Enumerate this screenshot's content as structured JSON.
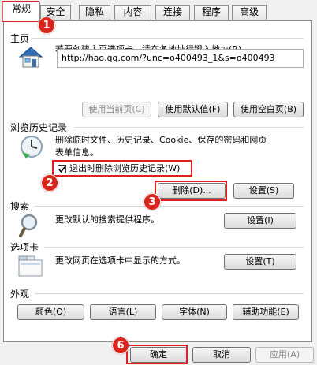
{
  "tabs": [
    {
      "label": "常规"
    },
    {
      "label": "安全"
    },
    {
      "label": "隐私"
    },
    {
      "label": "内容"
    },
    {
      "label": "连接"
    },
    {
      "label": "程序"
    },
    {
      "label": "高级"
    }
  ],
  "home": {
    "title": "主页",
    "description": "若要创建主页选项卡，请在各地址行键入地址(R)。",
    "url": "http://hao.qq.com/?unc=o400493_1&s=o400493",
    "btn_current": "使用当前页(C)",
    "btn_default": "使用默认值(F)",
    "btn_blank": "使用空白页(B)"
  },
  "history": {
    "title": "浏览历史记录",
    "description_line1": "删除临时文件、历史记录、Cookie、保存的密码和网页",
    "description_line2": "表单信息。",
    "checkbox_label": "退出时删除浏览历史记录(W)",
    "checkbox_checked": true,
    "btn_delete": "删除(D)...",
    "btn_settings": "设置(S)"
  },
  "search": {
    "title": "搜索",
    "description": "更改默认的搜索提供程序。",
    "btn_settings": "设置(I)"
  },
  "tabs_section": {
    "title": "选项卡",
    "description": "更改网页在选项卡中显示的方式。",
    "btn_settings": "设置(T)"
  },
  "appearance": {
    "title": "外观",
    "btn_colors": "颜色(O)",
    "btn_languages": "语言(L)",
    "btn_fonts": "字体(N)",
    "btn_accessibility": "辅助功能(E)"
  },
  "footer": {
    "btn_ok": "确定",
    "btn_cancel": "取消",
    "btn_apply": "应用(A)"
  },
  "annotations": {
    "step1": "1",
    "step2": "2",
    "step3": "3",
    "step6": "6",
    "color": "#e02020"
  }
}
